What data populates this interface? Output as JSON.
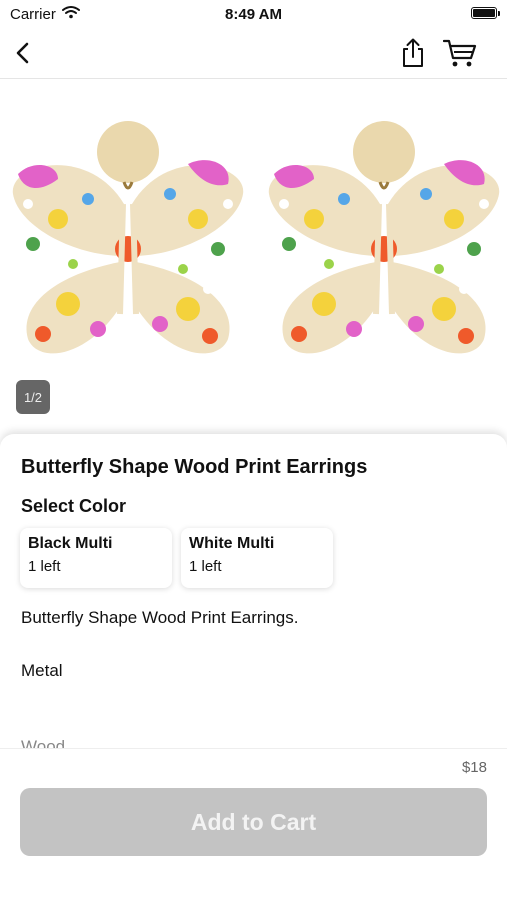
{
  "status_bar": {
    "carrier": "Carrier",
    "time": "8:49 AM"
  },
  "gallery": {
    "page_indicator": "1/2"
  },
  "product": {
    "title": "Butterfly Shape Wood Print Earrings",
    "select_color_label": "Select Color",
    "colors": [
      {
        "name": "Black Multi",
        "stock": "1 left"
      },
      {
        "name": "White Multi",
        "stock": "1 left"
      }
    ],
    "description": [
      "Butterfly Shape Wood Print Earrings.",
      "Metal",
      "Wood"
    ]
  },
  "footer": {
    "price": "$18",
    "add_to_cart": "Add to Cart"
  }
}
